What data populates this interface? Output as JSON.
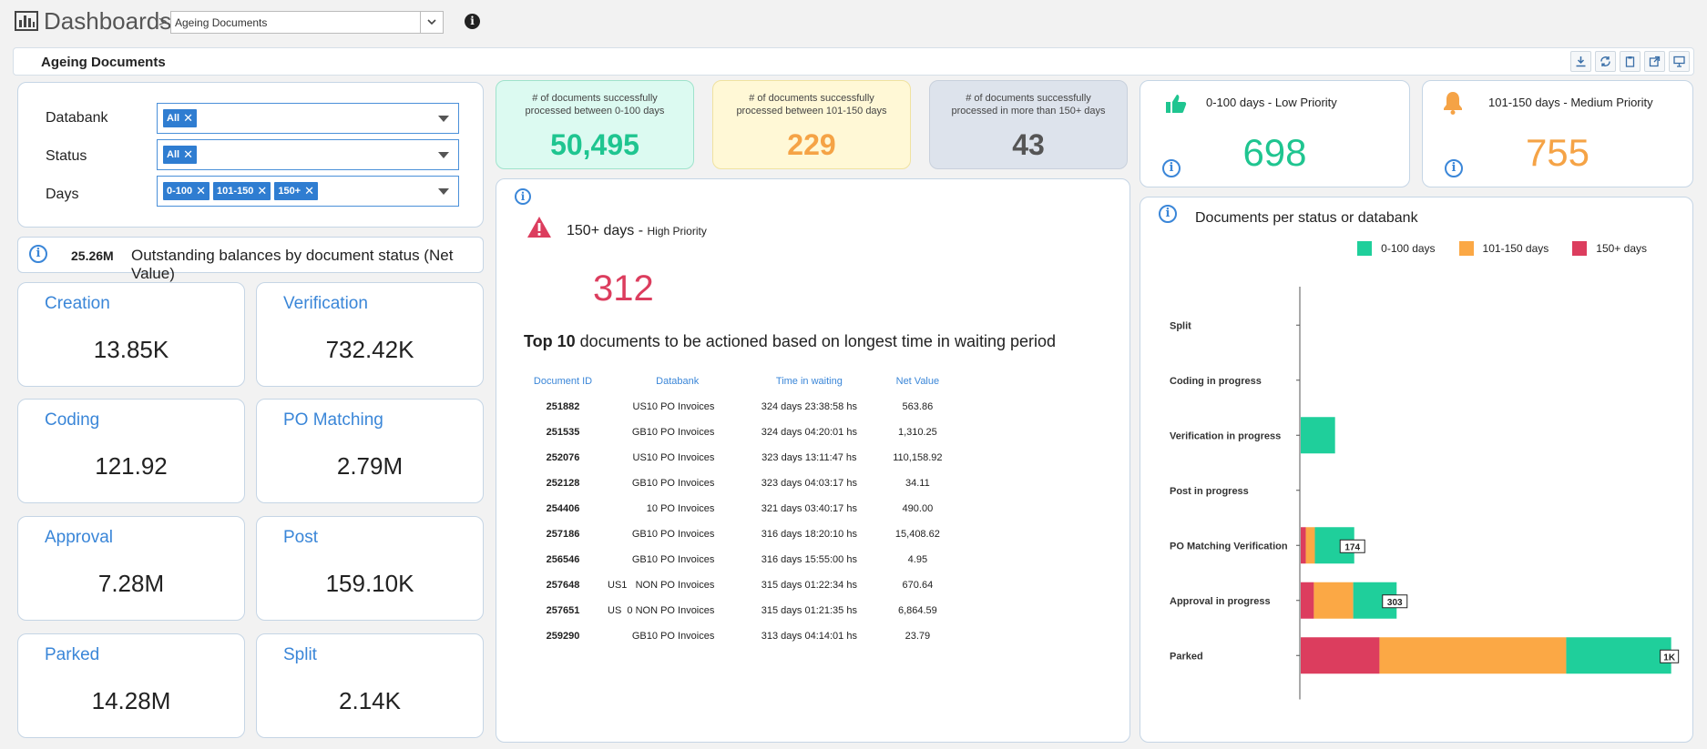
{
  "header": {
    "title": "Dashboards",
    "separator": ">",
    "dashboard_select": "Ageing Documents",
    "info_glyph": "i"
  },
  "titlebar": {
    "title": "Ageing Documents"
  },
  "filters": {
    "databank": {
      "label": "Databank",
      "tags": [
        "All"
      ]
    },
    "status": {
      "label": "Status",
      "tags": [
        "All"
      ]
    },
    "days": {
      "label": "Days",
      "tags": [
        "0-100",
        "101-150",
        "150+"
      ]
    }
  },
  "outstanding": {
    "value": "25.26M",
    "label": "Outstanding balances by document status (Net Value)"
  },
  "stats": [
    {
      "name": "Creation",
      "value": "13.85K"
    },
    {
      "name": "Verification",
      "value": "732.42K"
    },
    {
      "name": "Coding",
      "value": "121.92"
    },
    {
      "name": "PO Matching",
      "value": "2.79M"
    },
    {
      "name": "Approval",
      "value": "7.28M"
    },
    {
      "name": "Post",
      "value": "159.10K"
    },
    {
      "name": "Parked",
      "value": "14.28M"
    },
    {
      "name": "Split",
      "value": "2.14K"
    }
  ],
  "kpis": [
    {
      "caption": "# of documents successfully processed between 0-100  days",
      "value": "50,495",
      "bg": "#dcfaf1",
      "border": "#9fe3cc",
      "color": "#1fc590"
    },
    {
      "caption": "# of documents successfully processed between 101-150  days",
      "value": "229",
      "bg": "#fff8d6",
      "border": "#f0e2a0",
      "color": "#f5a346"
    },
    {
      "caption": "# of documents successfully processed in more than 150+ days",
      "value": "43",
      "bg": "#dde3ec",
      "border": "#c8d0dc",
      "color": "#555555"
    }
  ],
  "low_priority": {
    "range": "0-100 days - ",
    "label": "Low Priority",
    "value": "698",
    "color": "#1fc590"
  },
  "medium_priority": {
    "range": "101-150 days - ",
    "label": "Medium Priority",
    "value": "755",
    "color": "#f5a346"
  },
  "high_priority": {
    "range": "150+ days - ",
    "label": "High Priority",
    "value": "312",
    "color": "#dc3d5e",
    "top_bold": "Top 10",
    "top_rest": " documents to be actioned based on longest time in waiting period"
  },
  "table": {
    "headers": [
      "Document ID",
      "Databank",
      "Time in waiting",
      "Net Value"
    ],
    "rows": [
      [
        "251882",
        "US10 PO Invoices",
        "324 days 23:38:58 hs",
        "563.86"
      ],
      [
        "251535",
        "GB10 PO Invoices",
        "324 days 04:20:01 hs",
        "1,310.25"
      ],
      [
        "252076",
        "US10 PO Invoices",
        "323 days 13:11:47 hs",
        "110,158.92"
      ],
      [
        "252128",
        "GB10 PO Invoices",
        "323 days 04:03:17 hs",
        "34.11"
      ],
      [
        "254406",
        "10 PO Invoices",
        "321 days 03:40:17 hs",
        "490.00"
      ],
      [
        "257186",
        "GB10 PO Invoices",
        "316 days 18:20:10 hs",
        "15,408.62"
      ],
      [
        "256546",
        "GB10 PO Invoices",
        "316 days 15:55:00 hs",
        "4.95"
      ],
      [
        "257648",
        "US1   NON PO Invoices",
        "315 days 01:22:34 hs",
        "670.64"
      ],
      [
        "257651",
        "US  0 NON PO Invoices",
        "315 days 01:21:35 hs",
        "6,864.59"
      ],
      [
        "259290",
        "GB10 PO Invoices",
        "313 days 04:14:01 hs",
        "23.79"
      ]
    ]
  },
  "chart_data": {
    "type": "bar",
    "orientation": "horizontal",
    "stacked": true,
    "title": "Documents per status or databank",
    "categories": [
      "Split",
      "Coding in progress",
      "Verification in progress",
      "Post in progress",
      "PO Matching Verification",
      "Approval in progress",
      "Parked"
    ],
    "series": [
      {
        "name": "150+ days",
        "color": "#dc3d5e",
        "values": [
          0,
          0,
          0,
          0,
          5,
          13,
          78
        ]
      },
      {
        "name": "101-150 days",
        "color": "#fba845",
        "values": [
          0,
          0,
          0,
          0,
          9,
          39,
          185
        ]
      },
      {
        "name": "0-100 days",
        "color": "#1fcf9b",
        "values": [
          0,
          0,
          34,
          0,
          39,
          43,
          104
        ]
      }
    ],
    "legend_order": [
      "0-100 days",
      "101-150 days",
      "150+ days"
    ],
    "data_labels": [
      "",
      "",
      "",
      "",
      "174",
      "303",
      "1K"
    ],
    "xlim": [
      0,
      370
    ],
    "legend_position": "top-right",
    "grid": false
  }
}
